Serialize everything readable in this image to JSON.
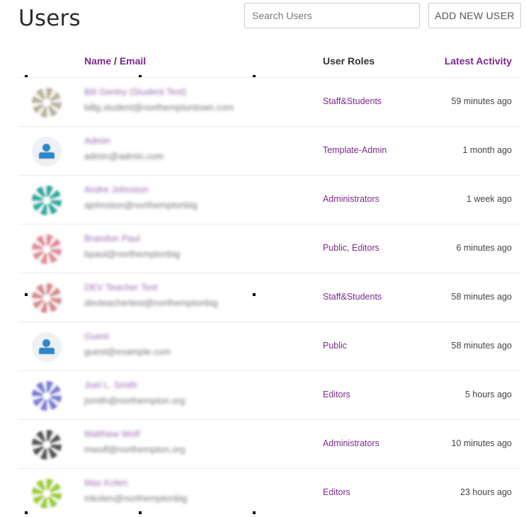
{
  "header": {
    "title": "Users",
    "search_placeholder": "Search Users",
    "add_button_label": "ADD NEW USER"
  },
  "columns": {
    "name": "Name",
    "separator": " / ",
    "email": "Email",
    "roles": "User Roles",
    "activity": "Latest Activity"
  },
  "users": [
    {
      "name": "Bill Gentry (Student Test)",
      "email": "billg.student@northemptontown.com",
      "role": "Staff&Students",
      "activity": "59 minutes ago",
      "avatar": "avatar-pattern-olive",
      "avatar_color": "#b9b49a"
    },
    {
      "name": "Admin",
      "email": "admin@admin.com",
      "role": "Template-Admin",
      "activity": "1 month ago",
      "avatar": "default-user-icon",
      "avatar_color": "#2e86c9"
    },
    {
      "name": "Andre Johnston",
      "email": "ajohnston@northemptonbig",
      "role": "Administrators",
      "activity": "1 week ago",
      "avatar": "avatar-pattern-teal",
      "avatar_color": "#2aa89a"
    },
    {
      "name": "Brandon Paul",
      "email": "bpaul@northemptonbig",
      "role": "Public, Editors",
      "activity": "6 minutes ago",
      "avatar": "avatar-pattern-pink",
      "avatar_color": "#e58a95"
    },
    {
      "name": "DEV Teacher Test",
      "email": "devteachertest@northemptonbig",
      "role": "Staff&Students",
      "activity": "58 minutes ago",
      "avatar": "avatar-pattern-rose",
      "avatar_color": "#d98a8a"
    },
    {
      "name": "Guest",
      "email": "guest@example.com",
      "role": "Public",
      "activity": "58 minutes ago",
      "avatar": "default-user-icon",
      "avatar_color": "#2e86c9"
    },
    {
      "name": "Joel L. Smith",
      "email": "jsmith@northempton.org",
      "role": "Editors",
      "activity": "5 hours ago",
      "avatar": "avatar-pattern-blue",
      "avatar_color": "#7a7ad9"
    },
    {
      "name": "Matthew Wolf",
      "email": "mwolf@northempton.org",
      "role": "Administrators",
      "activity": "10 minutes ago",
      "avatar": "avatar-pattern-dark",
      "avatar_color": "#555555"
    },
    {
      "name": "Max Kolen",
      "email": "mkolen@northemptonbig",
      "role": "Editors",
      "activity": "23 hours ago",
      "avatar": "avatar-pattern-lime",
      "avatar_color": "#9acd32"
    }
  ],
  "colors": {
    "accent": "#7b2a8c",
    "text": "#333333",
    "border": "#cfcfcf"
  }
}
